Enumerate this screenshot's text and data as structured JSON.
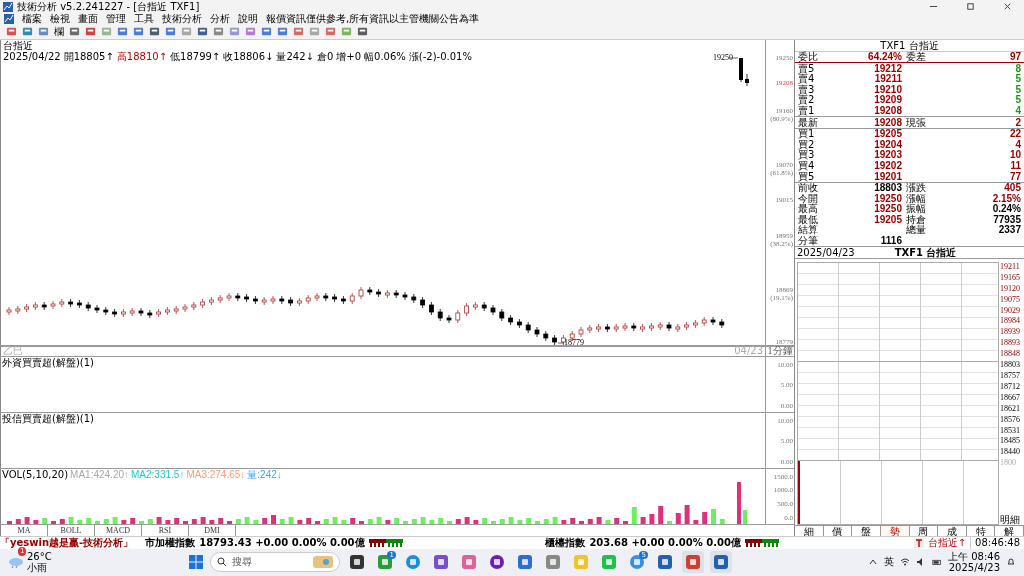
{
  "window": {
    "title": "技術分析 v5.2.241227 - [台指近 TXF1]"
  },
  "menu": [
    "檔案",
    "檢視",
    "畫面",
    "管理",
    "工具",
    "技術分析",
    "分析",
    "說明"
  ],
  "notice": "報價資訊僅供參考,所有資訊以主管機關公告為準",
  "toolbar": {
    "label": "欄"
  },
  "chart": {
    "symbol": "台指近",
    "info": [
      {
        "text": "2025/04/22",
        "kind": "plain"
      },
      {
        "text": "開18805↑",
        "kind": "plain"
      },
      {
        "text": "高18810↑",
        "kind": "up"
      },
      {
        "text": "低18799↑",
        "kind": "plain"
      },
      {
        "text": "收18806↓",
        "kind": "plain"
      },
      {
        "text": "量242↓",
        "kind": "plain"
      },
      {
        "text": "倉0",
        "kind": "plain"
      },
      {
        "text": "增+0",
        "kind": "plain"
      },
      {
        "text": "幅0.06%",
        "kind": "plain"
      },
      {
        "text": "漲(-2)-0.01%",
        "kind": "plain"
      }
    ],
    "high_label": "19250",
    "low_label": "18779",
    "session": "乙巳",
    "period": "1分鐘",
    "date": "04/23",
    "price_axis": [
      {
        "label": "19250",
        "current": false
      },
      {
        "label": "19208",
        "current": true
      },
      {
        "label": "19160",
        "ratio": "(80.9%)",
        "current": false
      },
      {
        "label": "19070",
        "ratio": "(61.8%)",
        "current": false
      },
      {
        "label": "19015",
        "current": false
      },
      {
        "label": "18959",
        "ratio": "(38.2%)",
        "current": false
      },
      {
        "label": "18869",
        "ratio": "(19.1%)",
        "current": false
      },
      {
        "label": "18779",
        "current": false
      }
    ]
  },
  "panes": [
    {
      "title": "外資買賣超(解盤)(1)",
      "axis": [
        "10.00",
        "5.00",
        "0.00"
      ]
    },
    {
      "title": "投信買賣超(解盤)(1)",
      "axis": [
        "10.00",
        "5.00",
        "0.00"
      ]
    }
  ],
  "volume": {
    "title": "VOL(5,10,20)",
    "ma": [
      {
        "text": "MA1:424.20↑",
        "color": "#a8a8a8"
      },
      {
        "text": "MA2:331.5↑",
        "color": "#19d0c8"
      },
      {
        "text": "MA3:274.65↓",
        "color": "#ff9a7a"
      },
      {
        "text": "量:242↓",
        "color": "#3aaaff"
      }
    ],
    "axis": [
      "1500.0",
      "1000.0",
      "500.0",
      "0.0"
    ]
  },
  "indicator_tabs": [
    {
      "label": "MA",
      "selected": false
    },
    {
      "label": "BOLL",
      "selected": false
    },
    {
      "label": "MACD",
      "selected": false
    },
    {
      "label": "RSI",
      "selected": false
    },
    {
      "label": "DMI",
      "selected": false
    }
  ],
  "quote": {
    "header": "TXF1 台指近",
    "ratio": {
      "label": "委比",
      "value": "64.24%",
      "label2": "委差",
      "value2": "97"
    },
    "asks": [
      {
        "label": "賣5",
        "price": "19212",
        "qty": "8"
      },
      {
        "label": "賣4",
        "price": "19211",
        "qty": "5"
      },
      {
        "label": "賣3",
        "price": "19210",
        "qty": "5"
      },
      {
        "label": "賣2",
        "price": "19209",
        "qty": "5"
      },
      {
        "label": "賣1",
        "price": "19208",
        "qty": "4"
      }
    ],
    "last": {
      "label": "最新",
      "price": "19208",
      "label2": "現張",
      "qty": "2"
    },
    "bids": [
      {
        "label": "買1",
        "price": "19205",
        "qty": "22"
      },
      {
        "label": "買2",
        "price": "19204",
        "qty": "4"
      },
      {
        "label": "買3",
        "price": "19203",
        "qty": "10"
      },
      {
        "label": "買4",
        "price": "19202",
        "qty": "11"
      },
      {
        "label": "買5",
        "price": "19201",
        "qty": "77"
      }
    ],
    "stats": [
      {
        "left": {
          "label": "前收",
          "value": "18803",
          "color": "#000000"
        },
        "right": {
          "label": "漲跌",
          "value": "405",
          "color": "#a00000"
        }
      },
      {
        "left": {
          "label": "今開",
          "value": "19250",
          "color": "#a00000"
        },
        "right": {
          "label": "漲幅",
          "value": "2.15%",
          "color": "#a00000"
        }
      },
      {
        "left": {
          "label": "最高",
          "value": "19250",
          "color": "#a00000"
        },
        "right": {
          "label": "振幅",
          "value": "0.24%",
          "color": "#000000"
        }
      },
      {
        "left": {
          "label": "最低",
          "value": "19205",
          "color": "#a00000"
        },
        "right": {
          "label": "持倉",
          "value": "77935",
          "color": "#000000"
        }
      },
      {
        "left": {
          "label": "結算"
        },
        "right": {
          "label": "總量",
          "value": "2337",
          "color": "#000000"
        }
      },
      {
        "left": {
          "label": "分筆",
          "value": "1116",
          "color": "#000000"
        }
      }
    ]
  },
  "tick_chart": {
    "date": "2025/04/23",
    "symbol": "TXF1 台指近",
    "axis_upper": [
      "19211",
      "19165",
      "19120",
      "19075",
      "19029",
      "18984",
      "18939",
      "18893",
      "18848"
    ],
    "axis_lower": [
      "18803",
      "18757",
      "18712",
      "18667",
      "18621",
      "18576",
      "18531",
      "18485",
      "18440"
    ],
    "volume_axis": "1800",
    "footer": "明細"
  },
  "side_tabs": [
    {
      "label": "細",
      "selected": false
    },
    {
      "label": "價",
      "selected": false
    },
    {
      "label": "盤",
      "selected": false
    },
    {
      "label": "勢",
      "selected": true
    },
    {
      "label": "周",
      "selected": false
    },
    {
      "label": "成",
      "selected": false
    },
    {
      "label": "特",
      "selected": false
    },
    {
      "label": "解",
      "selected": false
    }
  ],
  "status": {
    "brand": "「yeswin越是贏-技術分析」",
    "indices": [
      {
        "name": "市加權指數",
        "value": "18793.43 +0.00 0.00% 0.00億"
      },
      {
        "name": "櫃檯指數",
        "value": "203.68 +0.00 0.00% 0.00億"
      }
    ],
    "alert": "台指近↑",
    "time": "08:46:48"
  },
  "taskbar": {
    "weather": {
      "temp": "26°C",
      "desc": "小雨",
      "badge": "1"
    },
    "search": "搜尋",
    "apps": [
      {
        "kind": "taskview"
      },
      {
        "kind": "xbox",
        "badge": "1"
      },
      {
        "kind": "edge"
      },
      {
        "kind": "camera"
      },
      {
        "kind": "copilot"
      },
      {
        "kind": "yahoo"
      },
      {
        "kind": "store"
      },
      {
        "kind": "font"
      },
      {
        "kind": "folder"
      },
      {
        "kind": "line"
      },
      {
        "kind": "chrome",
        "badge": "5"
      },
      {
        "kind": "chart"
      },
      {
        "kind": "tool",
        "selected": true
      },
      {
        "kind": "chart",
        "selected": true
      }
    ],
    "lang": "英",
    "time": "上午 08:46",
    "date": "2025/4/23"
  }
}
